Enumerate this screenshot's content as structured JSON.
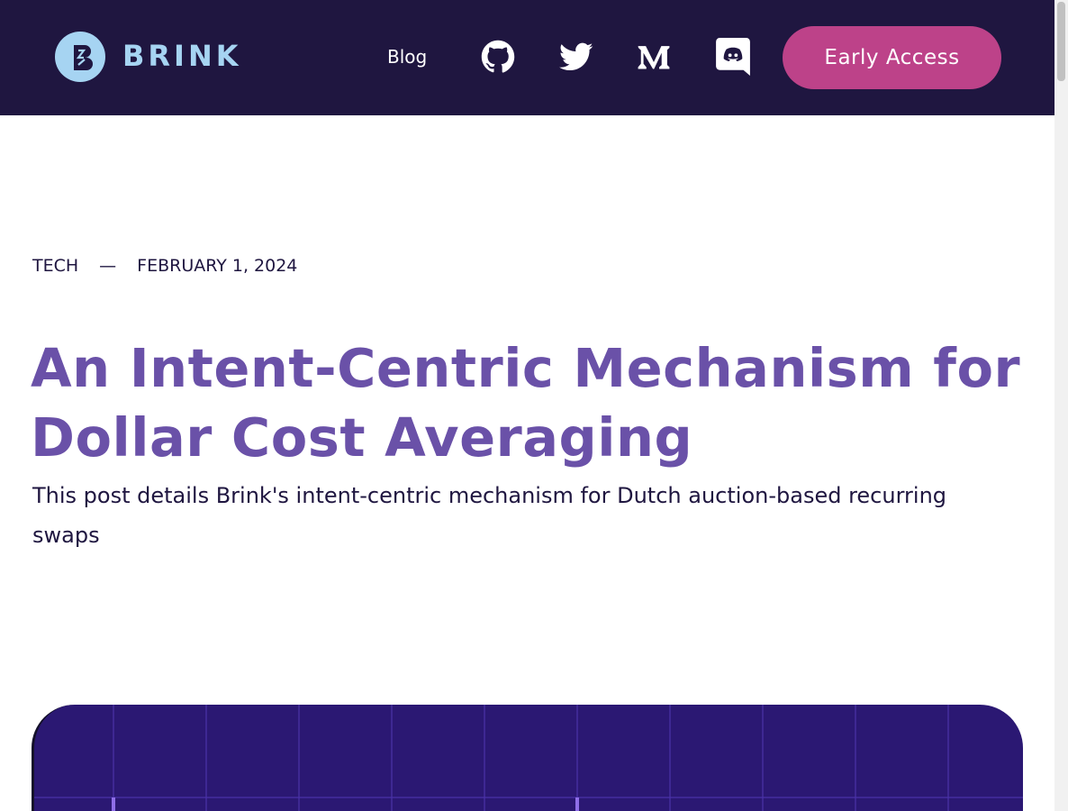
{
  "header": {
    "brand": "BRINK",
    "nav": {
      "blog_label": "Blog",
      "icons": [
        "github-icon",
        "twitter-icon",
        "medium-icon",
        "discord-icon"
      ]
    },
    "cta_label": "Early Access"
  },
  "post": {
    "category": "TECH",
    "separator": "—",
    "date": "FEBRUARY 1, 2024",
    "title": "An Intent-Centric Mechanism for Dollar Cost Averaging",
    "subtitle": "This post details Brink's intent-centric mechanism for Dutch auction-based recurring swaps"
  },
  "colors": {
    "header_bg": "#1f1640",
    "brand": "#a6d4f2",
    "cta_bg": "#bd4289",
    "title": "#6a51a8",
    "hero_bg": "#2b1873"
  }
}
